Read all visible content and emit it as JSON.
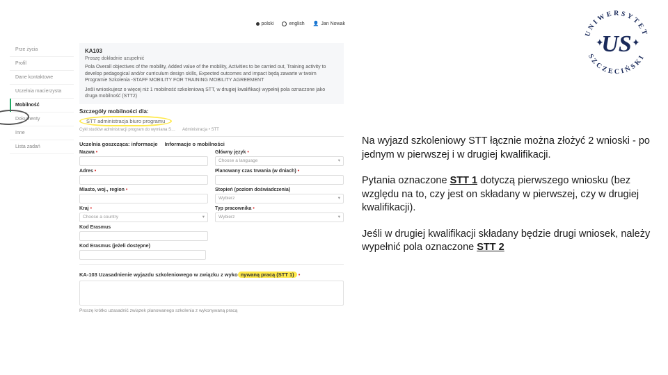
{
  "topbar": {
    "lang_pl": "polski",
    "lang_en": "english",
    "user": "Jan Nowak"
  },
  "sidebar": {
    "items": [
      {
        "label": "Prze życia"
      },
      {
        "label": "Profil"
      },
      {
        "label": "Dane kontaktowe"
      },
      {
        "label": "Uczelnia macierzysta"
      },
      {
        "label": "Mobilność"
      },
      {
        "label": "Dokumenty"
      },
      {
        "label": "Inne"
      },
      {
        "label": "Lista zadań"
      }
    ]
  },
  "card": {
    "code": "KA103",
    "subtitle": "Proszę dokładnie uzupełnić",
    "body1": "Pola Overall objectives of the mobility, Added value of the mobility, Activities to be carried out, Training activity to develop pedagogical and/or curriculum design skills, Expected outcomes and impact będą zawarte w twoim Programie Szkolenia -STAFF MOBILITY FOR TRAINING MOBILITY AGREEMENT",
    "body2": "Jeśli wnioskujesz o więcej niż 1 mobilność szkoleniową STT, w drugiej kwalifikacji wypełnij pola oznaczone jako druga mobilność (STT2)"
  },
  "details": {
    "heading": "Szczegóły mobilności dla:",
    "highlighted": "STT administracja biuro programu",
    "meta_left": "Cykl studiów administracji program do wymiana S…",
    "meta_right": "Administracja • STT",
    "col_left_title": "Uczelnia goszcząca: informacje",
    "col_right_title": "Informacje o mobilności",
    "nazwa_label": "Nazwa",
    "adres_label": "Adres",
    "miasto_label": "Miasto, woj., region",
    "kraj_label": "Kraj",
    "kraj_placeholder": "Choose a country",
    "kod_label": "Kod Erasmus",
    "kod2_label": "Kod Erasmus (jeżeli dostępne)",
    "jezyk_label": "Główny język",
    "jezyk_placeholder": "Choose a language",
    "czas_label": "Planowany czas trwania (w dniach)",
    "stopien_label": "Stopień (poziom doświadczenia)",
    "stopien_placeholder": "Wybierz",
    "typ_label": "Typ pracownika",
    "typ_placeholder": "Wybierz"
  },
  "stt": {
    "prefix": "KA-103 Uzasadnienie wyjazdu szkoleniowego w związku z wyko",
    "highlighted": "nywaną pracą (STT 1)",
    "hint": "Proszę krótko uzasadnić związek planowanego szkolenia z wykonywaną pracą"
  },
  "info": {
    "p1": "Na wyjazd szkoleniowy STT łącznie można złożyć 2 wnioski - po jednym w pierwszej i w drugiej kwalifikacji.",
    "p2a": "Pytania oznaczone ",
    "p2b": "STT 1",
    "p2c": " dotyczą pierwszego wniosku (bez względu na to, czy jest on składany w pierwszej, czy w drugiej kwalifikacji).",
    "p3a": "Jeśli w drugiej kwalifikacji składany będzie drugi wniosek, należy wypełnić pola oznaczone ",
    "p3b": "STT 2"
  },
  "logo": {
    "top_text": "UNIWERSYTET",
    "bottom_text": "SZCZECIŃSKI",
    "initials": "US"
  }
}
